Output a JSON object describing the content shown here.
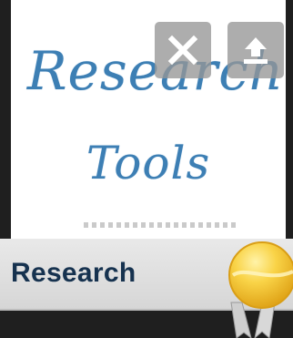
{
  "thumbnail": {
    "title_line1": "Research",
    "title_line2": "Tools",
    "close_icon": "close-icon",
    "upload_icon": "upload-icon"
  },
  "banner": {
    "label": "Research",
    "icon": "award-ribbon-icon"
  },
  "colors": {
    "title_blue": "#3d7fb4",
    "label_navy": "#16324f",
    "medal_gold": "#f5c431",
    "banner_gray": "#dedede",
    "background": "#1f1f1f"
  }
}
